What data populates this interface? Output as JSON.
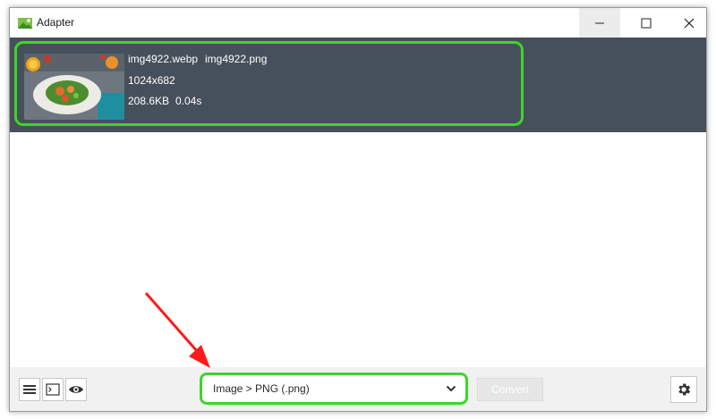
{
  "window": {
    "title": "Adapter"
  },
  "file": {
    "source_name": "img4922.webp",
    "output_name": "img4922.png",
    "dimensions": "1024x682",
    "size": "208.6KB",
    "time": "0.04s",
    "thumbnail": "food-plate-photo"
  },
  "toolbar": {
    "format_value": "Image > PNG (.png)",
    "convert_label": "Convert"
  },
  "icons": {
    "menu": "hamburger-icon",
    "terminal": "terminal-icon",
    "preview": "eye-icon",
    "settings": "gear-icon",
    "dropdown": "chevron-down-icon"
  },
  "colors": {
    "highlight": "#3fd42c",
    "panel": "#46505a",
    "arrow": "#ff1a1a"
  }
}
